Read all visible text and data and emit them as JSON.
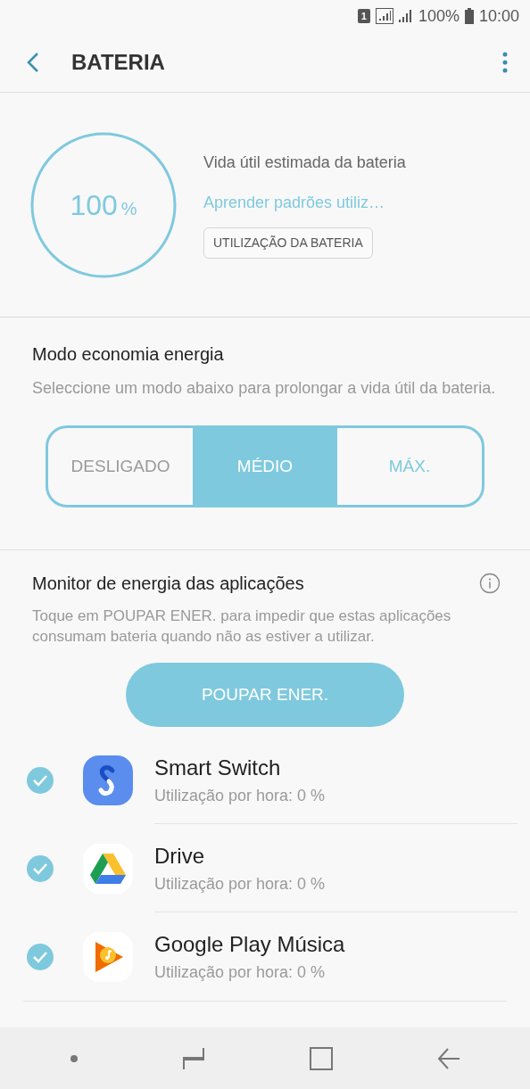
{
  "status_bar": {
    "sim": "1",
    "battery": "100%",
    "time": "10:00"
  },
  "header": {
    "title": "BATERIA"
  },
  "battery": {
    "level": 1,
    "value": "100",
    "unit": "%",
    "label": "Vida útil estimada da bateria",
    "link": "Aprender padrões utiliz…",
    "button": "UTILIZAÇÃO DA BATERIA"
  },
  "power_saving": {
    "title": "Modo economia energia",
    "description": "Seleccione um modo abaixo para prolongar a vida útil da bateria.",
    "modes": [
      {
        "label": "DESLIGADO",
        "selected": false
      },
      {
        "label": "MÉDIO",
        "selected": true
      },
      {
        "label": "MÁX.",
        "selected": false
      }
    ]
  },
  "app_monitor": {
    "title": "Monitor de energia das aplicações",
    "description": "Toque em POUPAR ENER. para impedir que estas aplicações consumam bateria quando não as estiver a utilizar.",
    "button": "POUPAR ENER.",
    "apps": [
      {
        "name": "Smart Switch",
        "usage": "Utilização por hora: 0 %",
        "checked": true
      },
      {
        "name": "Drive",
        "usage": "Utilização por hora: 0 %",
        "checked": true
      },
      {
        "name": "Google Play Música",
        "usage": "Utilização por hora: 0 %",
        "checked": true
      }
    ]
  }
}
